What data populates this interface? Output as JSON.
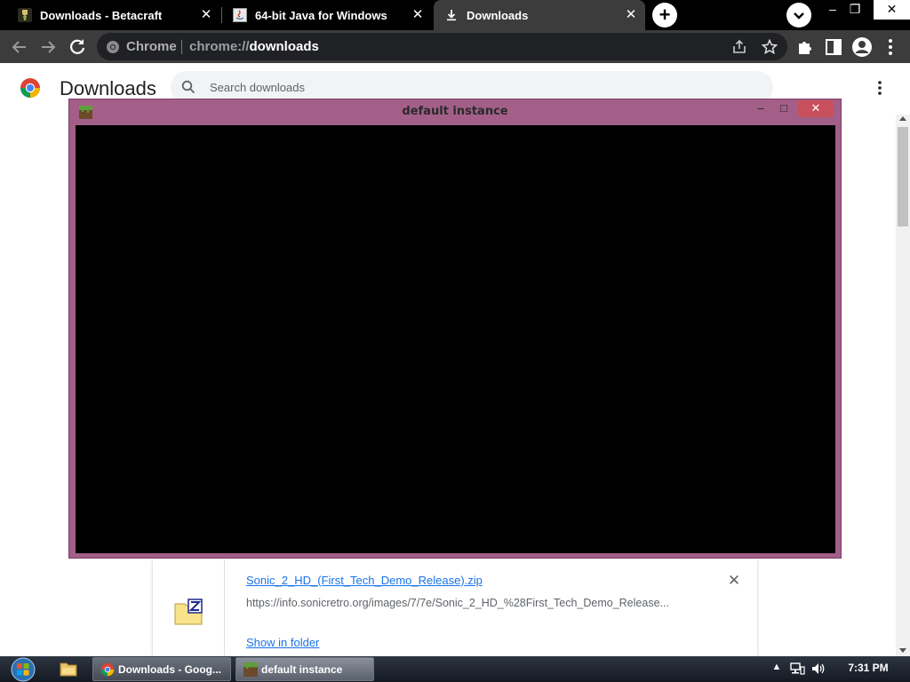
{
  "browser": {
    "tabs": [
      {
        "title": "Downloads - Betacraft",
        "favicon": "betacraft-icon",
        "active": false
      },
      {
        "title": "64-bit Java for Windows",
        "favicon": "java-icon",
        "active": false
      },
      {
        "title": "Downloads",
        "favicon": "download-icon",
        "active": true
      }
    ],
    "omnibox": {
      "site_label": "Chrome",
      "url_scheme": "chrome://",
      "url_host": "downloads"
    }
  },
  "downloads_page": {
    "title": "Downloads",
    "search": {
      "placeholder": "Search downloads",
      "value": ""
    },
    "items": [
      {
        "filename": "Sonic_2_HD_(First_Tech_Demo_Release).zip",
        "source_url": "https://info.sonicretro.org/images/7/7e/Sonic_2_HD_%28First_Tech_Demo_Release...",
        "action_label": "Show in folder",
        "icon": "zip-file-icon"
      }
    ]
  },
  "game_window": {
    "title": "default instance",
    "icon": "minecraft-grass-block-icon",
    "controls": {
      "minimize": "–",
      "maximize": "□",
      "close": "✕"
    }
  },
  "taskbar": {
    "apps": [
      {
        "label": "Downloads - Goog...",
        "icon": "chrome-icon",
        "active": false
      },
      {
        "label": "default instance",
        "icon": "minecraft-grass-block-icon",
        "active": true
      }
    ],
    "clock": "7:31 PM"
  },
  "colors": {
    "game_window_frame": "#a35f88",
    "game_close_button": "#c8505c",
    "chrome_dark_tabstrip": "#000000",
    "chrome_dark_toolbar": "#3c3c3c",
    "link_blue": "#1a73e8"
  }
}
